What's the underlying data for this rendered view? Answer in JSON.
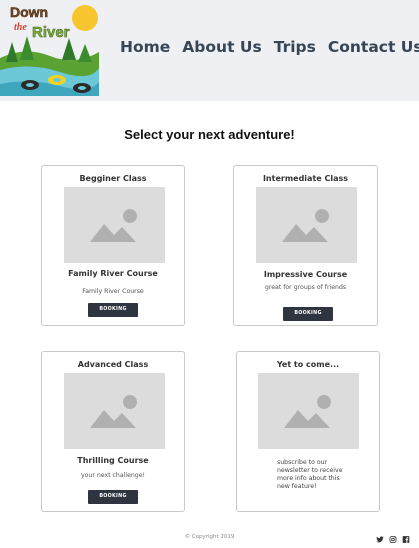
{
  "logo": {
    "line1": "Down",
    "line2": "the",
    "line3": "River"
  },
  "nav": {
    "items": [
      "Home",
      "About Us",
      "Trips",
      "Contact Us"
    ]
  },
  "headline": "Select your next adventure!",
  "cards": [
    {
      "title": "Begginer Class",
      "subtitle": "Family River Course",
      "description": "Family River Course",
      "button": "BOOKING"
    },
    {
      "title": "Intermediate Class",
      "subtitle": "Impressive Course",
      "description": "great for groups of friends",
      "button": "BOOKING"
    },
    {
      "title": "Advanced Class",
      "subtitle": "Thrilling Course",
      "description": "your next challenge!",
      "button": "BOOKING"
    },
    {
      "title": "Yet to come...",
      "note": [
        "subscribe to our",
        "newsletter to receive",
        "more info about this",
        "new feature!"
      ]
    }
  ],
  "footer": {
    "copyright": "© Copyright 2019",
    "social_icons": [
      "twitter-icon",
      "instagram-icon",
      "facebook-icon"
    ]
  },
  "colors": {
    "header_bg": "#eef0f3",
    "nav_text": "#374556",
    "button_bg": "#2e3440",
    "placeholder_bg": "#dcdcdc"
  }
}
